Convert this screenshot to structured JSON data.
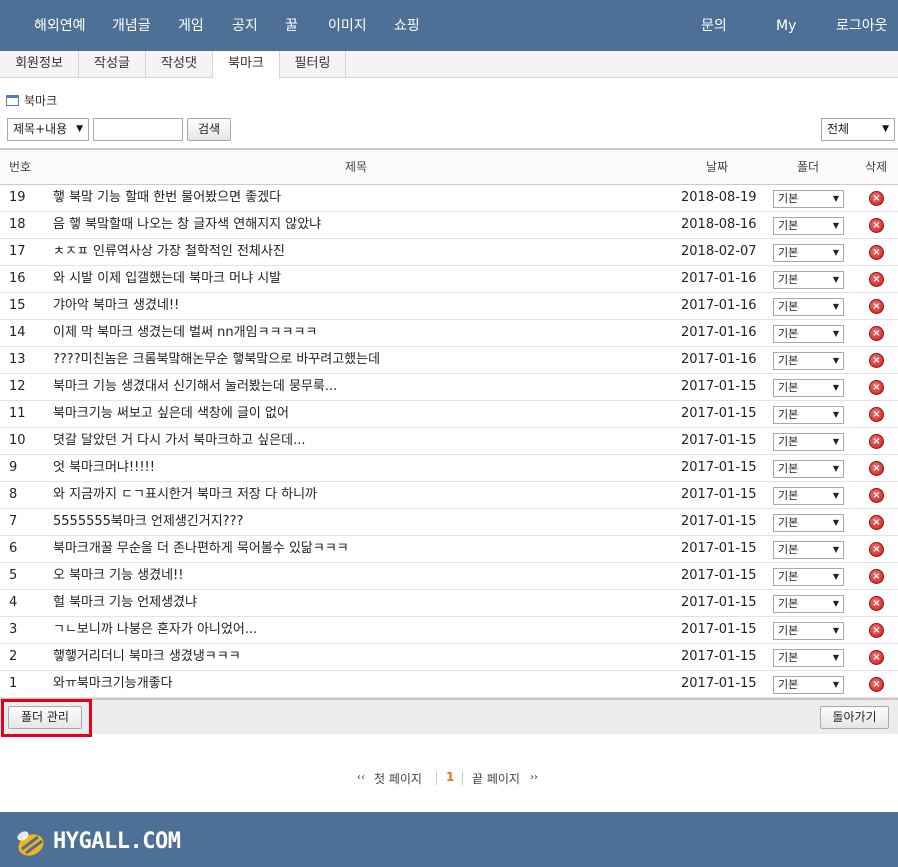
{
  "top_nav": {
    "left": [
      "해외연예",
      "개념글",
      "게임",
      "공지",
      "꿀",
      "이미지",
      "쇼핑"
    ],
    "right": [
      "문의",
      "My",
      "로그아웃"
    ]
  },
  "tabs": [
    "회원정보",
    "작성글",
    "작성댓",
    "북마크",
    "필터링"
  ],
  "page_title": "북마크",
  "search": {
    "scope": "제목+내용",
    "query": "",
    "button": "검색",
    "filter": "전체"
  },
  "table": {
    "headers": {
      "num": "번호",
      "title": "제목",
      "date": "날짜",
      "folder": "폴더",
      "delete": "삭제"
    },
    "rows": [
      {
        "num": "19",
        "title": "햏 북맠 기능 할때 한번 물어봤으면 좋겠다",
        "date": "2018-08-19",
        "folder": "기본"
      },
      {
        "num": "18",
        "title": "음 햏 북맠할때 나오는 창 글자색 연해지지 않았냐",
        "date": "2018-08-16",
        "folder": "기본"
      },
      {
        "num": "17",
        "title": "ㅊㅈㅍ 인류역사상 가장 철학적인 전체사진",
        "date": "2018-02-07",
        "folder": "기본"
      },
      {
        "num": "16",
        "title": "와 시발 이제 입갤했는데 북마크 머냐 시발",
        "date": "2017-01-16",
        "folder": "기본"
      },
      {
        "num": "15",
        "title": "갸아악 북마크 생겼네!!",
        "date": "2017-01-16",
        "folder": "기본"
      },
      {
        "num": "14",
        "title": "이제 막 북마크 생겼는데 벌써 nn개임ㅋㅋㅋㅋㅋ",
        "date": "2017-01-16",
        "folder": "기본"
      },
      {
        "num": "13",
        "title": "????미친놈은 크롬북맠해논무순 햏북맠으로 바꾸려고했는데",
        "date": "2017-01-16",
        "folder": "기본"
      },
      {
        "num": "12",
        "title": "북마크 기능 생겼대서 신기해서 눌러봤는데 뭉무룩...",
        "date": "2017-01-15",
        "folder": "기본"
      },
      {
        "num": "11",
        "title": "북마크기능 써보고 싶은데 색창에 글이 없어",
        "date": "2017-01-15",
        "folder": "기본"
      },
      {
        "num": "10",
        "title": "뎟갈 달았던 거 다시 가서 북마크하고 싶은데...",
        "date": "2017-01-15",
        "folder": "기본"
      },
      {
        "num": "9",
        "title": "엇 북마크머냐!!!!!",
        "date": "2017-01-15",
        "folder": "기본"
      },
      {
        "num": "8",
        "title": "와 지금까지 ㄷㄱ표시한거 북마크 저장 다 하니까",
        "date": "2017-01-15",
        "folder": "기본"
      },
      {
        "num": "7",
        "title": "5555555북마크 언제생긴거지???",
        "date": "2017-01-15",
        "folder": "기본"
      },
      {
        "num": "6",
        "title": "북마크개꿀 무순을 더 존나편하게 묵어볼수 있닮ㅋㅋㅋ",
        "date": "2017-01-15",
        "folder": "기본"
      },
      {
        "num": "5",
        "title": "오 북마크 기능 생겼네!!",
        "date": "2017-01-15",
        "folder": "기본"
      },
      {
        "num": "4",
        "title": "헐 북마크 기능 언제생겼냐",
        "date": "2017-01-15",
        "folder": "기본"
      },
      {
        "num": "3",
        "title": "ㄱㄴ보니까 나붕은 혼자가 아니었어...",
        "date": "2017-01-15",
        "folder": "기본"
      },
      {
        "num": "2",
        "title": "햏햏거리더니 북마크 생겼냉ㅋㅋㅋ",
        "date": "2017-01-15",
        "folder": "기본"
      },
      {
        "num": "1",
        "title": "와ㅠ북마크기능개좋다",
        "date": "2017-01-15",
        "folder": "기본"
      }
    ]
  },
  "footer_buttons": {
    "manage": "폴더 관리",
    "back": "돌아가기"
  },
  "pager": {
    "first_arrow": "‹‹",
    "first": "첫 페이지",
    "current": "1",
    "last": "끝 페이지",
    "last_arrow": "››"
  },
  "footer": {
    "logo": "HYGALL.COM"
  },
  "colors": {
    "nav_bg": "#4e7096",
    "highlight": "#e5001b",
    "current_page": "#e8731b"
  }
}
